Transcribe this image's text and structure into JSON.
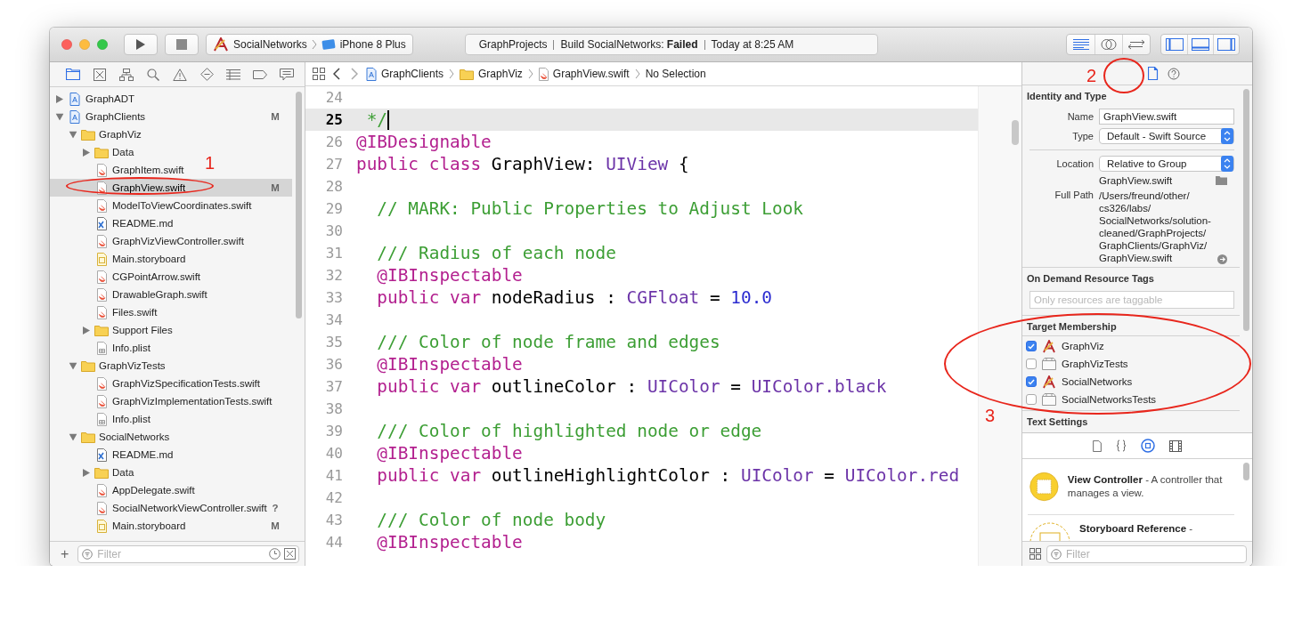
{
  "toolbar": {
    "scheme": {
      "target": "SocialNetworks",
      "device": "iPhone 8 Plus"
    },
    "activity": {
      "project": "GraphProjects",
      "status": "Build SocialNetworks: **Failed**",
      "time": "Today at 8:25 AM"
    },
    "editor_modes": [
      {
        "selected": true
      },
      {
        "selected": false
      },
      {
        "selected": false
      }
    ],
    "panels": [
      {
        "on": true
      },
      {
        "on": true
      },
      {
        "on": true
      }
    ]
  },
  "navigator": {
    "tabs": [
      {
        "selected": true
      },
      {
        "selected": false
      },
      {
        "selected": false
      },
      {
        "selected": false
      },
      {
        "selected": false
      },
      {
        "selected": false
      },
      {
        "selected": false
      },
      {
        "selected": false
      },
      {
        "selected": false
      }
    ],
    "tree": [
      {
        "name": "GraphADT",
        "kind": "project",
        "expanded": false,
        "selected": false
      },
      {
        "name": "GraphClients",
        "kind": "project",
        "expanded": true,
        "selected": false,
        "status": "M",
        "children": [
          {
            "name": "GraphViz",
            "kind": "folder",
            "expanded": true,
            "selected": false,
            "children": [
              {
                "name": "Data",
                "kind": "folder",
                "expanded": false,
                "selected": false
              },
              {
                "name": "GraphItem.swift",
                "kind": "swift",
                "selected": false
              },
              {
                "name": "GraphView.swift",
                "kind": "swift",
                "selected": true,
                "status": "M"
              },
              {
                "name": "ModelToViewCoordinates.swift",
                "kind": "swift",
                "selected": false
              },
              {
                "name": "README.md",
                "kind": "markdown",
                "selected": false
              },
              {
                "name": "GraphVizViewController.swift",
                "kind": "swift",
                "selected": false
              },
              {
                "name": "Main.storyboard",
                "kind": "storyboard",
                "selected": false
              },
              {
                "name": "CGPointArrow.swift",
                "kind": "swift",
                "selected": false
              },
              {
                "name": "DrawableGraph.swift",
                "kind": "swift",
                "selected": false
              },
              {
                "name": "Files.swift",
                "kind": "swift",
                "selected": false
              },
              {
                "name": "Support Files",
                "kind": "folder",
                "expanded": false,
                "selected": false
              },
              {
                "name": "Info.plist",
                "kind": "plist",
                "selected": false
              }
            ]
          },
          {
            "name": "GraphVizTests",
            "kind": "folder",
            "expanded": true,
            "selected": false,
            "children": [
              {
                "name": "GraphVizSpecificationTests.swift",
                "kind": "swift",
                "selected": false
              },
              {
                "name": "GraphVizImplementationTests.swift",
                "kind": "swift",
                "selected": false
              },
              {
                "name": "Info.plist",
                "kind": "plist",
                "selected": false
              }
            ]
          },
          {
            "name": "SocialNetworks",
            "kind": "folder",
            "expanded": true,
            "selected": false,
            "children": [
              {
                "name": "README.md",
                "kind": "markdown",
                "selected": false
              },
              {
                "name": "Data",
                "kind": "folder",
                "expanded": false,
                "selected": false
              },
              {
                "name": "AppDelegate.swift",
                "kind": "swift",
                "selected": false
              },
              {
                "name": "SocialNetworkViewController.swift",
                "kind": "swift",
                "selected": false,
                "status": "?"
              },
              {
                "name": "Main.storyboard",
                "kind": "storyboard",
                "selected": false,
                "status": "M"
              }
            ]
          }
        ]
      }
    ],
    "add_button": "+",
    "filter": {
      "placeholder": "Filter"
    }
  },
  "editor": {
    "jump_bar": [
      {
        "text": "GraphClients",
        "kind": "project"
      },
      {
        "text": "GraphViz",
        "kind": "folder"
      },
      {
        "text": "GraphView.swift",
        "kind": "swift"
      },
      {
        "text": "No Selection",
        "kind": "none"
      }
    ],
    "lines": [
      {
        "number": "24",
        "current": false
      },
      {
        "number": "25",
        "current": true,
        "tokens": [
          {
            "text": " */",
            "kind": "comment"
          }
        ]
      },
      {
        "number": "26",
        "current": false,
        "tokens": [
          {
            "text": "@IBDesignable",
            "kind": "keyword"
          }
        ]
      },
      {
        "number": "27",
        "current": false,
        "tokens": [
          {
            "text": "public class ",
            "kind": "keyword"
          },
          {
            "text": "GraphView: ",
            "kind": "plain"
          },
          {
            "text": "UIView",
            "kind": "type"
          },
          {
            "text": " {",
            "kind": "plain"
          }
        ]
      },
      {
        "number": "28",
        "current": false
      },
      {
        "number": "29",
        "current": false,
        "tokens": [
          {
            "text": "  // MARK: Public Properties to Adjust Look",
            "kind": "comment"
          }
        ]
      },
      {
        "number": "30",
        "current": false
      },
      {
        "number": "31",
        "current": false,
        "tokens": [
          {
            "text": "  /// Radius of each node",
            "kind": "comment"
          }
        ]
      },
      {
        "number": "32",
        "current": false,
        "tokens": [
          {
            "text": "  @IBInspectable",
            "kind": "keyword"
          }
        ]
      },
      {
        "number": "33",
        "current": false,
        "tokens": [
          {
            "text": "  public var ",
            "kind": "keyword"
          },
          {
            "text": "nodeRadius : ",
            "kind": "plain"
          },
          {
            "text": "CGFloat",
            "kind": "type"
          },
          {
            "text": " = ",
            "kind": "plain"
          },
          {
            "text": "10.0",
            "kind": "number"
          }
        ]
      },
      {
        "number": "34",
        "current": false
      },
      {
        "number": "35",
        "current": false,
        "tokens": [
          {
            "text": "  /// Color of node frame and edges",
            "kind": "comment"
          }
        ]
      },
      {
        "number": "36",
        "current": false,
        "tokens": [
          {
            "text": "  @IBInspectable",
            "kind": "keyword"
          }
        ]
      },
      {
        "number": "37",
        "current": false,
        "tokens": [
          {
            "text": "  public var ",
            "kind": "keyword"
          },
          {
            "text": "outlineColor : ",
            "kind": "plain"
          },
          {
            "text": "UIColor",
            "kind": "type"
          },
          {
            "text": " = ",
            "kind": "plain"
          },
          {
            "text": "UIColor.black",
            "kind": "type"
          }
        ]
      },
      {
        "number": "38",
        "current": false
      },
      {
        "number": "39",
        "current": false,
        "tokens": [
          {
            "text": "  /// Color of highlighted node or edge",
            "kind": "comment"
          }
        ]
      },
      {
        "number": "40",
        "current": false,
        "tokens": [
          {
            "text": "  @IBInspectable",
            "kind": "keyword"
          }
        ]
      },
      {
        "number": "41",
        "current": false,
        "tokens": [
          {
            "text": "  public var ",
            "kind": "keyword"
          },
          {
            "text": "outlineHighlightColor : ",
            "kind": "plain"
          },
          {
            "text": "UIColor",
            "kind": "type"
          },
          {
            "text": " = ",
            "kind": "plain"
          },
          {
            "text": "UIColor.red",
            "kind": "type"
          }
        ]
      },
      {
        "number": "42",
        "current": false
      },
      {
        "number": "43",
        "current": false,
        "tokens": [
          {
            "text": "  /// Color of node body",
            "kind": "comment"
          }
        ]
      },
      {
        "number": "44",
        "current": false,
        "tokens": [
          {
            "text": "  @IBInspectable",
            "kind": "keyword"
          }
        ]
      }
    ]
  },
  "inspector": {
    "tabs": [
      {
        "selected": true
      },
      {
        "selected": false
      }
    ],
    "identity": {
      "title": "Identity and Type",
      "name_label": "Name",
      "name": "GraphView.swift",
      "type_label": "Type",
      "type": "Default - Swift Source",
      "location_label": "Location",
      "location": "Relative to Group",
      "file_name": "GraphView.swift",
      "full_path_label": "Full Path",
      "full_path_lines": [
        "/Users/freund/other/",
        "cs326/labs/",
        "SocialNetworks/solution-",
        "cleaned/GraphProjects/",
        "GraphClients/GraphViz/",
        "GraphView.swift"
      ]
    },
    "tags": {
      "title": "On Demand Resource Tags",
      "placeholder": "Only resources are taggable"
    },
    "membership": {
      "title": "Target Membership",
      "targets": [
        {
          "name": "GraphViz",
          "kind": "app",
          "checked": true
        },
        {
          "name": "GraphVizTests",
          "kind": "bundle",
          "checked": false
        },
        {
          "name": "SocialNetworks",
          "kind": "app",
          "checked": true
        },
        {
          "name": "SocialNetworksTests",
          "kind": "bundle",
          "checked": false
        }
      ]
    },
    "text_settings": {
      "title": "Text Settings"
    }
  },
  "library": {
    "tabs": [
      {
        "selected": false
      },
      {
        "selected": false
      },
      {
        "selected": true
      },
      {
        "selected": false
      }
    ],
    "items": [
      {
        "kind": "solid",
        "description": "**View Controller** - A controller that manages a view."
      },
      {
        "kind": "dashed",
        "description": "**Storyboard Reference** -"
      }
    ],
    "filter": {
      "placeholder": "Filter"
    }
  },
  "annotations": [
    {
      "label": "1"
    },
    {
      "label": "2"
    },
    {
      "label": "3"
    }
  ]
}
